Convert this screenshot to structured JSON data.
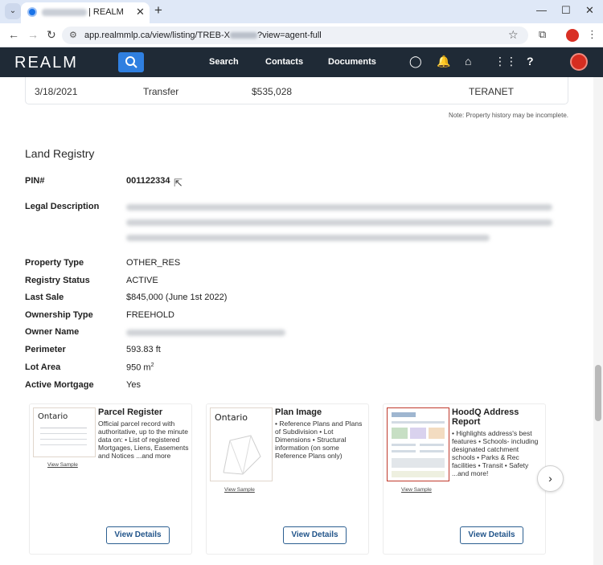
{
  "browser": {
    "tab_title": "| REALM",
    "url": "app.realmmlp.ca/view/listing/TREB-X",
    "url_suffix": "?view=agent-full",
    "new_tab": "+",
    "close_tab": "✕"
  },
  "header": {
    "logo": "REALM",
    "nav": [
      "Search",
      "Contacts",
      "Documents"
    ]
  },
  "history": {
    "date": "3/18/2021",
    "event": "Transfer",
    "price": "$535,028",
    "source": "TERANET",
    "note": "Note: Property history may be incomplete."
  },
  "land_registry": {
    "title": "Land Registry",
    "pin_label": "PIN#",
    "pin_value": "001122334",
    "legal_label": "Legal Description",
    "property_type_label": "Property Type",
    "property_type": "OTHER_RES",
    "registry_status_label": "Registry Status",
    "registry_status": "ACTIVE",
    "last_sale_label": "Last Sale",
    "last_sale": "$845,000 (June 1st 2022)",
    "ownership_label": "Ownership Type",
    "ownership": "FREEHOLD",
    "owner_label": "Owner Name",
    "perimeter_label": "Perimeter",
    "perimeter": "593.83 ft",
    "lot_area_label": "Lot Area",
    "lot_area": "950 m",
    "lot_area_sup": "2",
    "mortgage_label": "Active Mortgage",
    "mortgage": "Yes"
  },
  "cards": [
    {
      "logo": "Ontario",
      "title": "Parcel Register",
      "desc": "Official parcel record with authoritative, up to the minute data on: • List of registered Mortgages, Liens, Easements and Notices ...and more",
      "sample": "View Sample",
      "button": "View Details"
    },
    {
      "logo": "Ontario",
      "title": "Plan Image",
      "desc": "• Reference Plans and Plans of Subdivision • Lot Dimensions • Structural information (on some Reference Plans only)",
      "sample": "View Sample",
      "button": "View Details"
    },
    {
      "title": "HoodQ Address Report",
      "desc": "• Highlights address's best features • Schools- including designated catchment schools • Parks & Rec facilities • Transit • Safety ...and more!",
      "sample": "View Sample",
      "button": "View Details"
    }
  ],
  "carousel": {
    "next": "›"
  }
}
